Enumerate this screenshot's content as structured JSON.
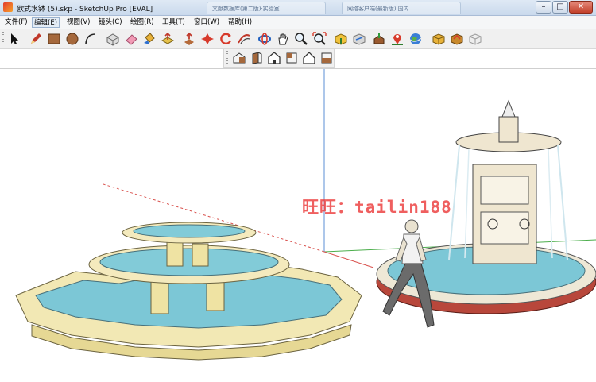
{
  "window": {
    "title": "欧式水钵 (5).skp - SketchUp Pro [EVAL]",
    "ghost_tabs": [
      "文献数据库(第二版)·实验室",
      "网络客户端(最新版)·国内"
    ],
    "minimize_label": "–",
    "maximize_label": "□",
    "close_label": "✕"
  },
  "menu": {
    "items": [
      "文件(F)",
      "编辑(E)",
      "视图(V)",
      "镜头(C)",
      "绘图(R)",
      "工具(T)",
      "窗口(W)",
      "帮助(H)"
    ],
    "active_index": 1
  },
  "toolbar_main": {
    "tools": [
      "select-tool-icon",
      "pencil-tool-icon",
      "rectangle-tool-icon",
      "circle-tool-icon",
      "arc-tool-icon",
      "make-component-icon",
      "eraser-tool-icon",
      "paint-bucket-icon",
      "push-pull-icon",
      "move-tool-icon",
      "rotate-tool-icon",
      "follow-me-icon",
      "offset-tool-icon",
      "orbit-tool-icon",
      "pan-tool-icon",
      "zoom-tool-icon",
      "zoom-extents-icon",
      "get-models-icon",
      "share-model-icon",
      "place-model-icon",
      "add-location-icon",
      "google-earth-icon",
      "share-component-icon",
      "extension-warehouse-icon",
      "component-options-icon"
    ]
  },
  "toolbar_views": {
    "tools": [
      "iso-view-icon",
      "front-view-icon",
      "top-view-icon",
      "right-view-icon",
      "back-view-icon",
      "left-view-icon"
    ]
  },
  "viewport": {
    "watermark": "旺旺：tailin188"
  },
  "colors": {
    "axis_red": "#d9534f",
    "axis_green": "#4cae4c",
    "axis_blue": "#5b8fd6",
    "stone": "#f2e8b4",
    "water": "#7cc7d6"
  }
}
